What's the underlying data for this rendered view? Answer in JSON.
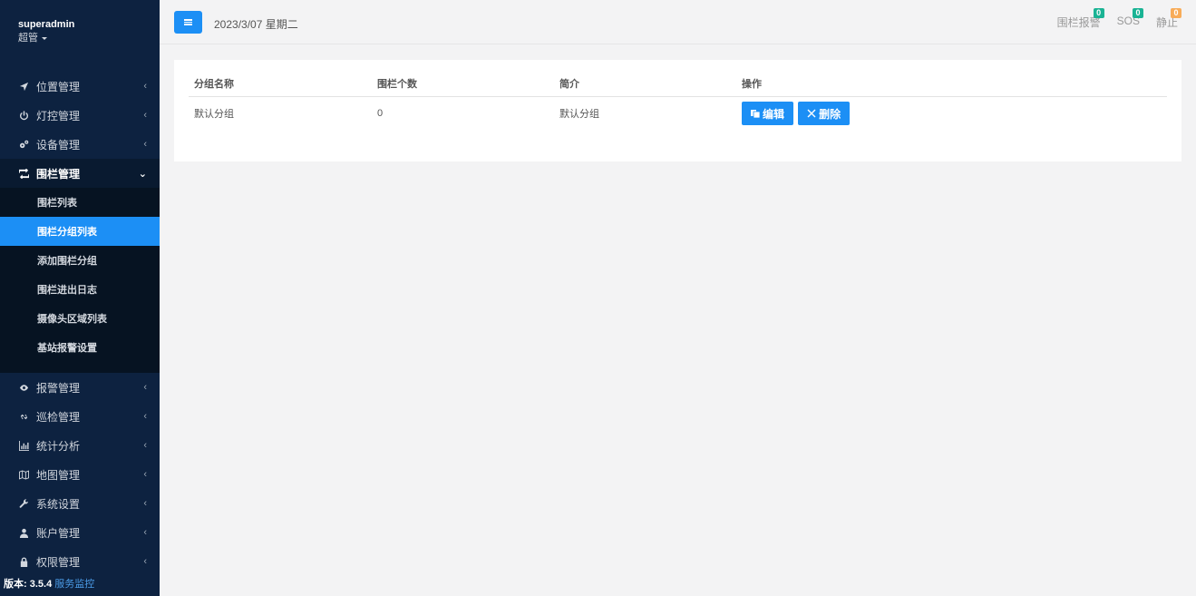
{
  "sidebar": {
    "username": "superadmin",
    "role": "超管",
    "menu": [
      {
        "label": "位置管理",
        "icon": "location-arrow-icon"
      },
      {
        "label": "灯控管理",
        "icon": "power-icon"
      },
      {
        "label": "设备管理",
        "icon": "cogs-icon"
      },
      {
        "label": "围栏管理",
        "icon": "retweet-icon"
      }
    ],
    "submenu": [
      {
        "label": "围栏列表"
      },
      {
        "label": "围栏分组列表"
      },
      {
        "label": "添加围栏分组"
      },
      {
        "label": "围栏进出日志"
      },
      {
        "label": "摄像头区域列表"
      },
      {
        "label": "基站报警设置"
      }
    ],
    "menu2": [
      {
        "label": "报警管理",
        "icon": "eye-icon"
      },
      {
        "label": "巡检管理",
        "icon": "chain-icon"
      },
      {
        "label": "统计分析",
        "icon": "bar-chart-icon"
      },
      {
        "label": "地图管理",
        "icon": "map-icon"
      },
      {
        "label": "系统设置",
        "icon": "wrench-icon"
      },
      {
        "label": "账户管理",
        "icon": "user-icon"
      },
      {
        "label": "权限管理",
        "icon": "lock-icon"
      }
    ],
    "version_label": "版本: 3.5.4",
    "service_link": "服务监控"
  },
  "header": {
    "date": "2023/3/07 星期二",
    "links": [
      {
        "label": "围栏报警",
        "badge": "0",
        "badge_color": "#1ab394"
      },
      {
        "label": "SOS",
        "badge": "0",
        "badge_color": "#1ab394"
      },
      {
        "label": "静止",
        "badge": "0",
        "badge_color": "#f8ac59"
      }
    ]
  },
  "table": {
    "columns": [
      "分组名称",
      "围栏个数",
      "简介",
      "操作"
    ],
    "rows": [
      {
        "name": "默认分组",
        "count": "0",
        "desc": "默认分组",
        "edit": "编辑",
        "delete": "删除"
      }
    ]
  },
  "colors": {
    "sidebar_bg": "#0d2240",
    "accent": "#1c8ff5",
    "page_bg": "#f3f3f4"
  }
}
